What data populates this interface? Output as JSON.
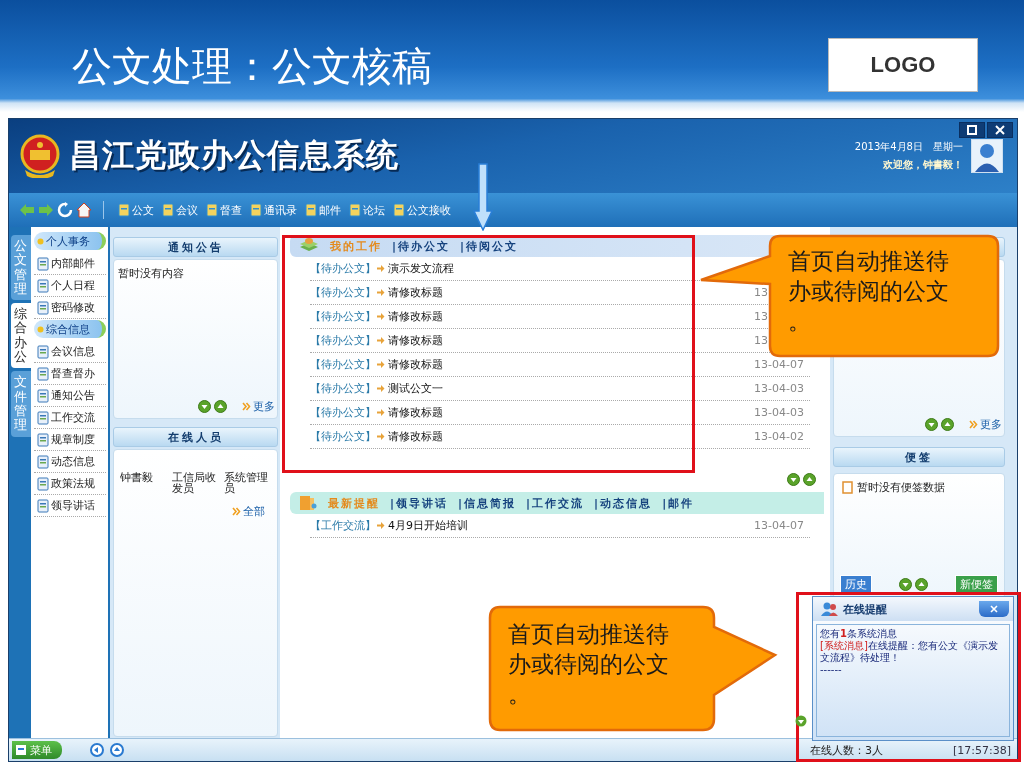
{
  "slide": {
    "title": "公文处理：公文核稿",
    "logo": "LOGO"
  },
  "app": {
    "title": "昌江党政办公信息系统",
    "date": "2013年4月8日　星期一",
    "welcome": "欢迎您，钟書毅！"
  },
  "toolbar": [
    {
      "label": "公文"
    },
    {
      "label": "会议"
    },
    {
      "label": "督查"
    },
    {
      "label": "通讯录"
    },
    {
      "label": "邮件"
    },
    {
      "label": "论坛"
    },
    {
      "label": "公文接收"
    }
  ],
  "vertical_tabs": [
    {
      "label": "公文管理",
      "selected": false
    },
    {
      "label": "综合办公",
      "selected": true
    },
    {
      "label": "文件管理",
      "selected": false
    }
  ],
  "sidebar": {
    "groups": [
      {
        "label": "个人事务",
        "items": [
          "内部邮件",
          "个人日程",
          "密码修改"
        ]
      },
      {
        "label": "综合信息",
        "items": [
          "会议信息",
          "督查督办",
          "通知公告",
          "工作交流",
          "规章制度",
          "动态信息",
          "政策法规",
          "领导讲话"
        ]
      }
    ]
  },
  "notice_panel": {
    "title": "通知公告",
    "text": "暂时没有内容",
    "more": "更多"
  },
  "online_panel": {
    "title": "在线人员",
    "users": [
      "钟書毅",
      "工信局收发员",
      "系统管理员"
    ],
    "all": "全部"
  },
  "my_work": {
    "tabs": [
      {
        "label": "我的工作",
        "selected": true
      },
      {
        "label": "|待办公文",
        "selected": false
      },
      {
        "label": "|待阅公文",
        "selected": false
      }
    ],
    "rows": [
      {
        "tag": "【待办公文】",
        "title": "演示发文流程"
      },
      {
        "tag": "【待办公文】",
        "title": "请修改标题",
        "date": "13"
      },
      {
        "tag": "【待办公文】",
        "title": "请修改标题",
        "date": "13"
      },
      {
        "tag": "【待办公文】",
        "title": "请修改标题",
        "date": "13"
      },
      {
        "tag": "【待办公文】",
        "title": "请修改标题",
        "date": "13-04-07"
      },
      {
        "tag": "【待办公文】",
        "title": "测试公文一",
        "date": "13-04-03"
      },
      {
        "tag": "【待办公文】",
        "title": "请修改标题",
        "date": "13-04-03"
      },
      {
        "tag": "【待办公文】",
        "title": "请修改标题",
        "date": "13-04-02"
      }
    ]
  },
  "reminders": {
    "tabs": [
      {
        "label": "最新提醒",
        "selected": true
      },
      {
        "label": "|领导讲话",
        "selected": false
      },
      {
        "label": "|信息简报",
        "selected": false
      },
      {
        "label": "|工作交流",
        "selected": false
      },
      {
        "label": "|动态信息",
        "selected": false
      },
      {
        "label": "|邮件",
        "selected": false
      }
    ],
    "rows": [
      {
        "tag": "【工作交流】",
        "title": "4月9日开始培训",
        "date": "13-04-07"
      }
    ]
  },
  "side_panel": {
    "more": "更多"
  },
  "notes": {
    "title": "便签",
    "empty": "暂时没有便签数据",
    "history": "历史",
    "new": "新便签"
  },
  "popup": {
    "title": "在线提醒",
    "summary": "您有**1**条系统消息",
    "tag": "[系统消息]",
    "message": "在线提醒：您有公文《演示发文流程》待处理！",
    "divider": "------"
  },
  "status_bar": {
    "menu": "菜单",
    "online": "在线人数：3人",
    "time": "[17:57:38]"
  },
  "callouts": [
    {
      "text": "首页自动推送待办或待阅的公文。"
    },
    {
      "text": "首页自动推送待办或待阅的公文。"
    }
  ]
}
